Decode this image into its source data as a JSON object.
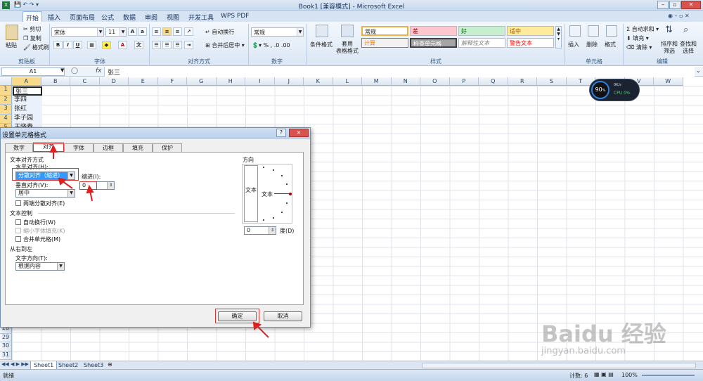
{
  "window": {
    "title": "Book1  [兼容模式] - Microsoft Excel"
  },
  "ribbon_tabs": [
    "开始",
    "插入",
    "页面布局",
    "公式",
    "数据",
    "审阅",
    "视图",
    "开发工具",
    "WPS PDF"
  ],
  "clipboard": {
    "paste": "粘贴",
    "cut": "剪切",
    "copy": "复制",
    "format_painter": "格式刷",
    "label": "剪贴板"
  },
  "font": {
    "name": "宋体",
    "size": "11",
    "label": "字体"
  },
  "alignment": {
    "wrap": "自动换行",
    "merge": "合并后居中",
    "label": "对齐方式"
  },
  "number": {
    "format": "常规",
    "label": "数字"
  },
  "styles": {
    "cond_format": "条件格式",
    "table_format": "套用\n表格格式",
    "items": [
      "常规",
      "差",
      "好",
      "适中",
      "计算",
      "检查单元格",
      "解释性文本",
      "警告文本"
    ],
    "label": "样式"
  },
  "cells": {
    "insert": "插入",
    "delete": "删除",
    "format": "格式",
    "label": "单元格"
  },
  "editing": {
    "autosum": "自动求和",
    "fill": "填充",
    "clear": "清除",
    "sort": "排序和\n筛选",
    "find": "查找和\n选择",
    "label": "编辑"
  },
  "formula_bar": {
    "name_box": "A1",
    "fx": "fx",
    "value": "张三"
  },
  "columns": [
    "A",
    "B",
    "C",
    "D",
    "E",
    "F",
    "G",
    "H",
    "I",
    "J",
    "K",
    "L",
    "M",
    "N",
    "O",
    "P",
    "Q",
    "R",
    "S",
    "T",
    "U",
    "V",
    "W"
  ],
  "rows_top": [
    "1",
    "2",
    "3",
    "4",
    "5"
  ],
  "rows_bottom": [
    "28",
    "29",
    "30",
    "31"
  ],
  "cell_values": [
    "张三",
    "李四",
    "张红",
    "李子园",
    "王晓春"
  ],
  "widget": {
    "percent": "90",
    "unit": "%",
    "speed": "0K/s",
    "cpu": "CPU 0%"
  },
  "dialog": {
    "title": "设置单元格格式",
    "help": "?",
    "close": "×",
    "tabs": [
      "数字",
      "对齐",
      "字体",
      "边框",
      "填充",
      "保护"
    ],
    "text_align_section": "文本对齐方式",
    "horizontal_label": "水平对齐(H):",
    "horizontal_value": "分散对齐（缩进）",
    "indent_label": "缩进(I):",
    "indent_value": "0",
    "vertical_label": "垂直对齐(V):",
    "vertical_value": "居中",
    "justify_distributed": "两端分散对齐(E)",
    "text_control_section": "文本控制",
    "wrap_text": "自动换行(W)",
    "shrink_to_fit": "缩小字体填充(K)",
    "merge_cells": "合并单元格(M)",
    "rtl_section": "从右到左",
    "direction_label": "文字方向(T):",
    "direction_value": "根据内容",
    "orientation_section": "方向",
    "vertical_text": "文本",
    "orientation_text": "文本",
    "degree_value": "0",
    "degree_label": "度(D)",
    "ok": "确定",
    "cancel": "取消"
  },
  "sheets": [
    "Sheet1",
    "Sheet2",
    "Sheet3"
  ],
  "status": {
    "ready": "就绪",
    "count": "计数: 6",
    "zoom": "100%"
  },
  "watermark": {
    "brand": "Baidu 经验",
    "url": "jingyan.baidu.com"
  }
}
